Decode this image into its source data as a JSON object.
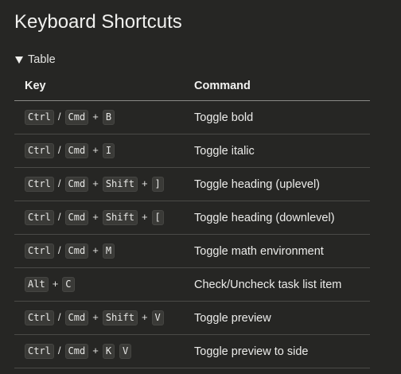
{
  "title": "Keyboard Shortcuts",
  "section": {
    "label": "Table"
  },
  "table": {
    "headers": {
      "key": "Key",
      "command": "Command"
    },
    "rows": [
      {
        "keys": [
          {
            "k": "Ctrl"
          },
          {
            "s": "/"
          },
          {
            "k": "Cmd"
          },
          {
            "s": "+"
          },
          {
            "k": "B"
          }
        ],
        "command": "Toggle bold"
      },
      {
        "keys": [
          {
            "k": "Ctrl"
          },
          {
            "s": "/"
          },
          {
            "k": "Cmd"
          },
          {
            "s": "+"
          },
          {
            "k": "I"
          }
        ],
        "command": "Toggle italic"
      },
      {
        "keys": [
          {
            "k": "Ctrl"
          },
          {
            "s": "/"
          },
          {
            "k": "Cmd"
          },
          {
            "s": "+"
          },
          {
            "k": "Shift"
          },
          {
            "s": "+"
          },
          {
            "k": "]"
          }
        ],
        "command": "Toggle heading (uplevel)"
      },
      {
        "keys": [
          {
            "k": "Ctrl"
          },
          {
            "s": "/"
          },
          {
            "k": "Cmd"
          },
          {
            "s": "+"
          },
          {
            "k": "Shift"
          },
          {
            "s": "+"
          },
          {
            "k": "["
          }
        ],
        "command": "Toggle heading (downlevel)"
      },
      {
        "keys": [
          {
            "k": "Ctrl"
          },
          {
            "s": "/"
          },
          {
            "k": "Cmd"
          },
          {
            "s": "+"
          },
          {
            "k": "M"
          }
        ],
        "command": "Toggle math environment"
      },
      {
        "keys": [
          {
            "k": "Alt"
          },
          {
            "s": "+"
          },
          {
            "k": "C"
          }
        ],
        "command": "Check/Uncheck task list item"
      },
      {
        "keys": [
          {
            "k": "Ctrl"
          },
          {
            "s": "/"
          },
          {
            "k": "Cmd"
          },
          {
            "s": "+"
          },
          {
            "k": "Shift"
          },
          {
            "s": "+"
          },
          {
            "k": "V"
          }
        ],
        "command": "Toggle preview"
      },
      {
        "keys": [
          {
            "k": "Ctrl"
          },
          {
            "s": "/"
          },
          {
            "k": "Cmd"
          },
          {
            "s": "+"
          },
          {
            "k": "K"
          },
          {
            "sp": true
          },
          {
            "k": "V"
          }
        ],
        "command": "Toggle preview to side"
      }
    ]
  }
}
